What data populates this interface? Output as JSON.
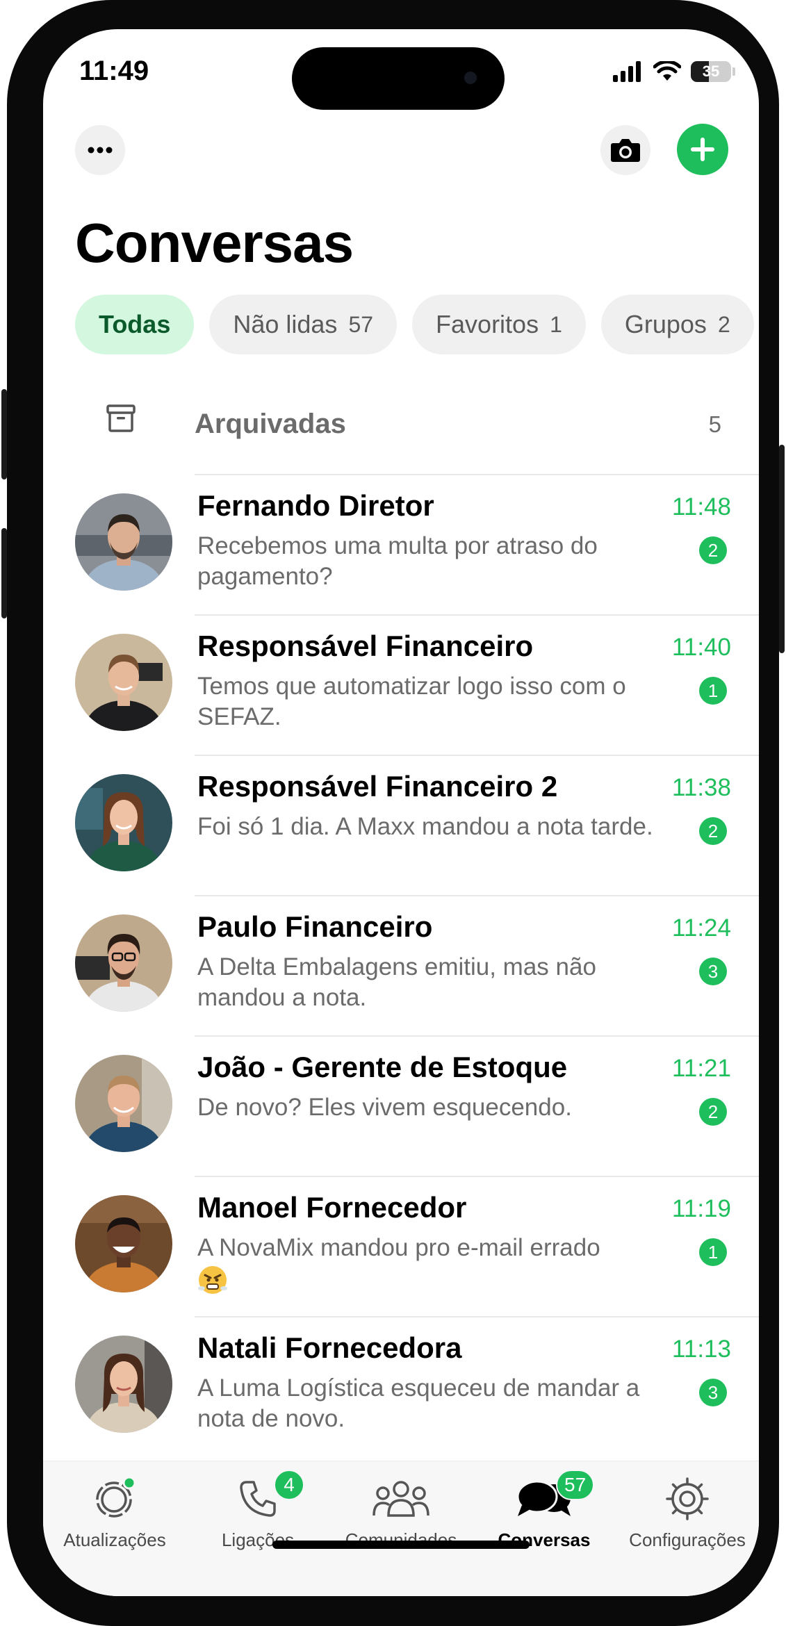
{
  "status_bar": {
    "time": "11:49",
    "battery": "35"
  },
  "header": {
    "title": "Conversas"
  },
  "filters": [
    {
      "label": "Todas",
      "count": ""
    },
    {
      "label": "Não lidas",
      "count": "57"
    },
    {
      "label": "Favoritos",
      "count": "1"
    },
    {
      "label": "Grupos",
      "count": "2"
    }
  ],
  "archived": {
    "label": "Arquivadas",
    "count": "5"
  },
  "chats": [
    {
      "name": "Fernando Diretor",
      "message": "Recebemos uma multa por atraso do pagamento?",
      "time": "11:48",
      "unread": "2"
    },
    {
      "name": "Responsável Financeiro",
      "message": "Temos que automatizar logo isso com o SEFAZ.",
      "time": "11:40",
      "unread": "1"
    },
    {
      "name": "Responsável Financeiro 2",
      "message": "Foi só 1 dia. A Maxx mandou a nota tarde.",
      "time": "11:38",
      "unread": "2"
    },
    {
      "name": "Paulo Financeiro",
      "message": "A Delta Embalagens emitiu, mas não mandou a nota.",
      "time": "11:24",
      "unread": "3"
    },
    {
      "name": "João - Gerente de Estoque",
      "message": "De novo? Eles vivem esquecendo.",
      "time": "11:21",
      "unread": "2"
    },
    {
      "name": "Manoel Fornecedor",
      "message": "A NovaMix mandou pro e-mail errado",
      "time": "11:19",
      "unread": "1"
    },
    {
      "name": "Natali Fornecedora",
      "message": "A Luma Logística esqueceu de mandar a nota de novo.",
      "time": "11:13",
      "unread": "3"
    }
  ],
  "tabbar": {
    "updates": "Atualizações",
    "calls": "Ligações",
    "calls_badge": "4",
    "communities": "Comunidades",
    "chats": "Conversas",
    "chats_badge": "57",
    "settings": "Configurações"
  },
  "colors": {
    "accent": "#1ebe5d",
    "active_chip_bg": "#d4f7df",
    "active_chip_text": "#0b5a2c"
  }
}
